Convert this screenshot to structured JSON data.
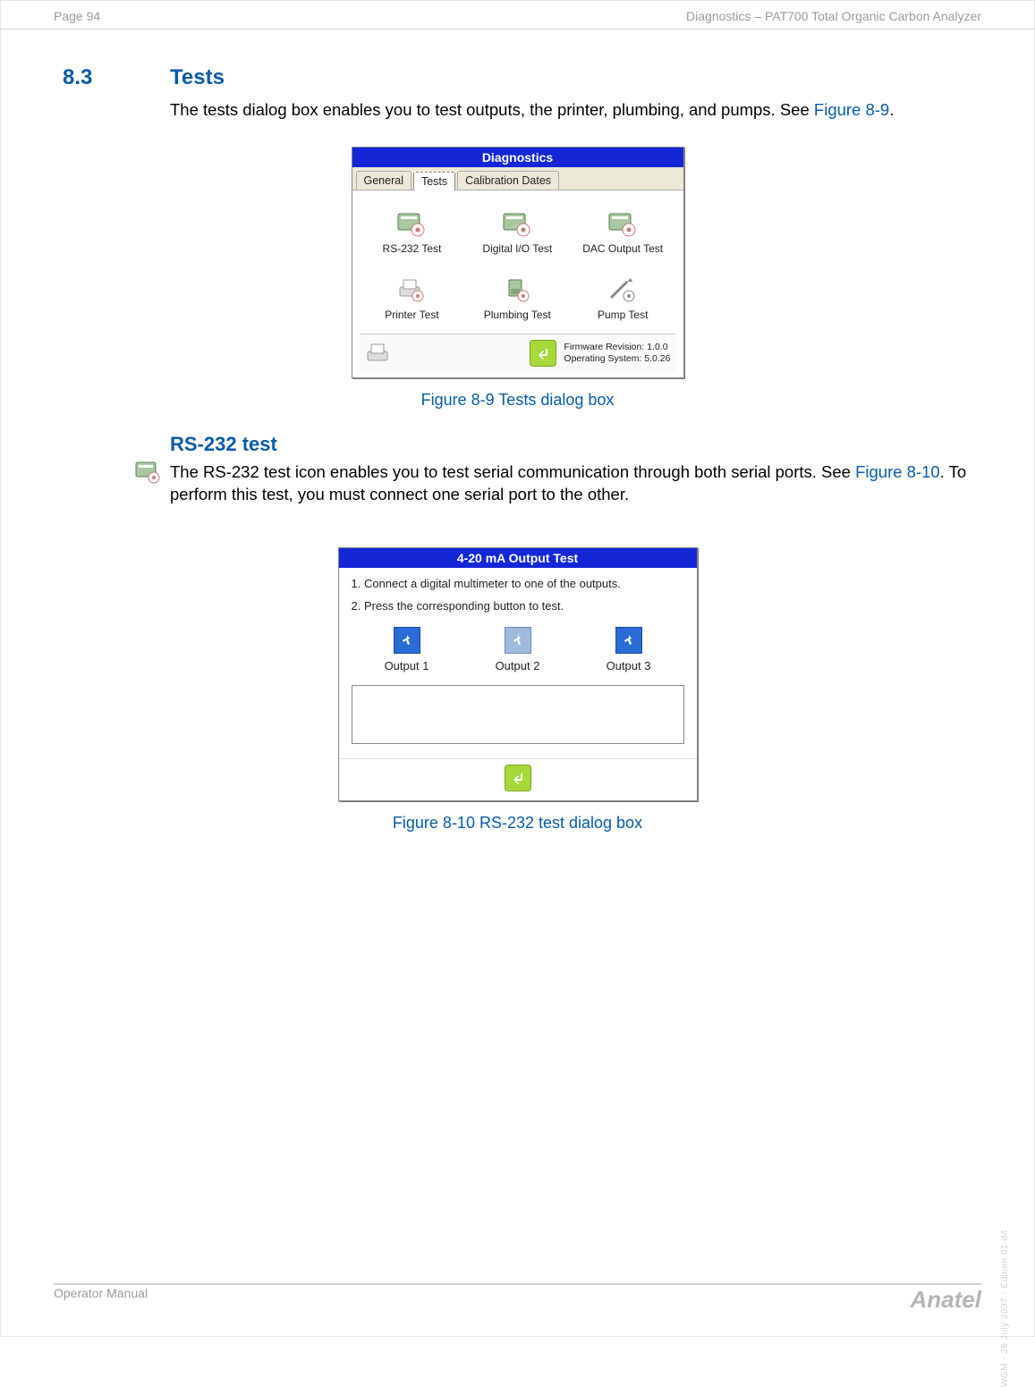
{
  "header": {
    "page_label": "Page 94",
    "doc_title": "Diagnostics – PAT700 Total Organic Carbon Analyzer"
  },
  "section": {
    "number": "8.3",
    "title": "Tests"
  },
  "intro": {
    "line1": "The tests dialog box enables you to test outputs, the printer, plumbing, and pumps. See ",
    "ref1": "Figure 8-9",
    "line1_tail": "."
  },
  "fig1": {
    "caption": "Figure 8-9 Tests dialog box",
    "dialog_title": "Diagnostics",
    "tabs": [
      "General",
      "Tests",
      "Calibration Dates"
    ],
    "icons": [
      "RS-232 Test",
      "Digital I/O Test",
      "DAC Output Test",
      "Printer Test",
      "Plumbing Test",
      "Pump Test"
    ],
    "status": {
      "line1": "Firmware Revision: 1.0.0",
      "line2": "Operating System: 5.0.26"
    }
  },
  "subhead": "RS-232 test",
  "rs232": {
    "line1a": "The RS-232 test icon enables you to test serial communication through both serial ports. See ",
    "ref2": "Figure 8-10",
    "line1b": ". To perform this test, you must connect one serial port to the other."
  },
  "fig2": {
    "caption": "Figure 8-10 RS-232 test dialog box",
    "dialog_title": "4-20 mA Output Test",
    "step1": "1. Connect a digital multimeter to one of the outputs.",
    "step2": "2. Press the corresponding button to test.",
    "outputs": [
      "Output 1",
      "Output 2",
      "Output 3"
    ]
  },
  "footer": {
    "left": "Operator Manual",
    "brand": "Anatel"
  },
  "side": "WGM - 26 July 2007 - Edition 01-d4"
}
